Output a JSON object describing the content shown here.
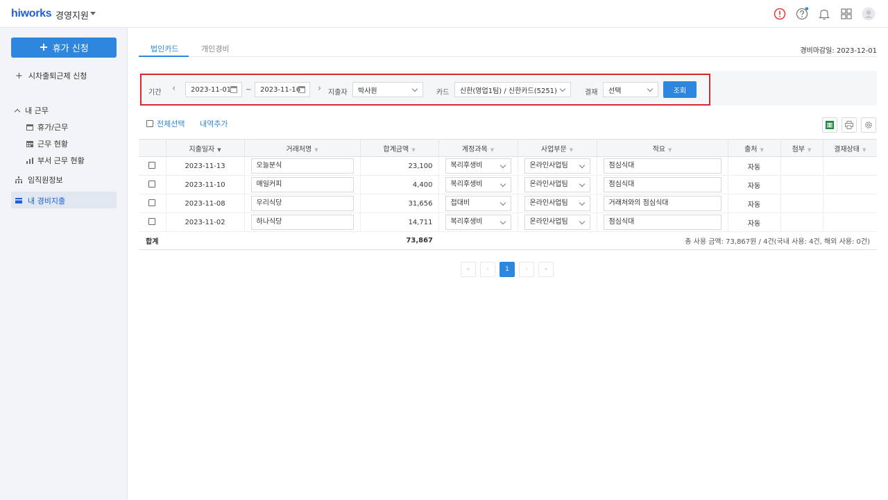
{
  "header": {
    "logo": "hiworks",
    "app_name": "경영지원"
  },
  "sidebar": {
    "primary_button": "휴가 신청",
    "correction_link": "시차출퇴근제 신청",
    "my_work_label": "내 근무",
    "sub_items": [
      "휴가/근무",
      "근무 현황",
      "부서 근무 현황"
    ],
    "employee_info": "임직원정보",
    "my_expense": "내 경비지출"
  },
  "tabs": [
    "법인카드",
    "개인경비"
  ],
  "closing_date": "경비마감일: 2023-12-01",
  "filter": {
    "period_label": "기간",
    "date_from": "2023-11-01",
    "date_to": "2023-11-16",
    "tilde": "~",
    "spender_label": "지출자",
    "spender_value": "박사원",
    "card_label": "카드",
    "card_value": "신한(영업1팀) / 신한카드(5251)",
    "approval_label": "결재",
    "approval_value": "선택",
    "search_button": "조회"
  },
  "actions": {
    "select_all": "전체선택",
    "add_item": "내역추가"
  },
  "table": {
    "headers": [
      "",
      "지출일자",
      "거래처명",
      "합계금액",
      "계정과목",
      "사업부문",
      "적요",
      "출처",
      "첨부",
      "결재상태"
    ],
    "rows": [
      {
        "date": "2023-11-13",
        "vendor": "오늘분식",
        "amount": "23,100",
        "account": "복리후생비",
        "division": "온라인사업팀",
        "memo": "점심식대",
        "source": "자동"
      },
      {
        "date": "2023-11-10",
        "vendor": "매일커피",
        "amount": "4,400",
        "account": "복리후생비",
        "division": "온라인사업팀",
        "memo": "점심식대",
        "source": "자동"
      },
      {
        "date": "2023-11-08",
        "vendor": "우리식당",
        "amount": "31,656",
        "account": "접대비",
        "division": "온라인사업팀",
        "memo": "거래처와의 점심식대",
        "source": "자동"
      },
      {
        "date": "2023-11-02",
        "vendor": "하나식당",
        "amount": "14,711",
        "account": "복리후생비",
        "division": "온라인사업팀",
        "memo": "점심식대",
        "source": "자동"
      }
    ],
    "total_label": "합계",
    "total_amount": "73,867",
    "summary": "총 사용 금액: 73,867원 / 4건(국내 사용: 4건, 해외 사용: 0건)"
  },
  "pagination": {
    "first": "«",
    "prev": "‹",
    "current": "1",
    "next": "›",
    "last": "»"
  },
  "colors": {
    "brand": "#1d5fd6",
    "accent": "#2e86de",
    "highlight_border": "#d8262e",
    "alert": "#e53935"
  }
}
